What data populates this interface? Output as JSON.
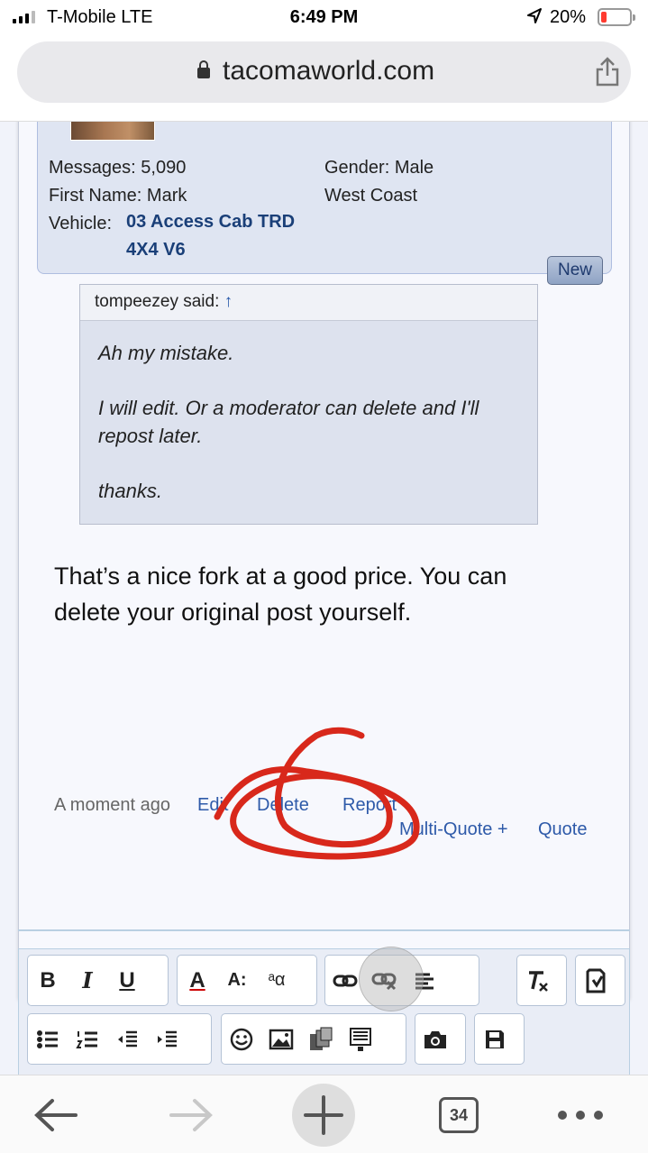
{
  "status_bar": {
    "carrier": "T-Mobile  LTE",
    "time": "6:49 PM",
    "battery_percent": "20%",
    "battery_level": 0.2
  },
  "browser": {
    "url": "tacomaworld.com"
  },
  "user_info": {
    "messages_label": "Messages:",
    "messages_value": "5,090",
    "first_name_label": "First Name:",
    "first_name_value": "Mark",
    "vehicle_label": "Vehicle:",
    "vehicle_line1": "03 Access Cab TRD",
    "vehicle_line2": "4X4 V6",
    "gender_label": "Gender:",
    "gender_value": "Male",
    "location": "West Coast"
  },
  "new_badge": "New",
  "quote": {
    "author_said": "tompeezey said:",
    "arrow": "↑",
    "lines": [
      "Ah my mistake.",
      "I will edit. Or a moderator can delete and I'll repost later.",
      "thanks."
    ]
  },
  "message": "That’s a nice fork at a good price. You can delete your original post yourself.",
  "post_meta": {
    "time": "A moment ago",
    "edit": "Edit",
    "delete": "Delete",
    "report": "Report",
    "multi_quote": "Multi-Quote +",
    "quote": "Quote"
  },
  "toolbar": {
    "bold": "B",
    "italic": "I",
    "underline": "U",
    "text_color": "A",
    "font_size": "A:",
    "font_family": "ᵃα"
  },
  "bottom_bar": {
    "tab_count": "34"
  },
  "colors": {
    "link": "#2e5aa9",
    "annotation": "#d8281b"
  }
}
